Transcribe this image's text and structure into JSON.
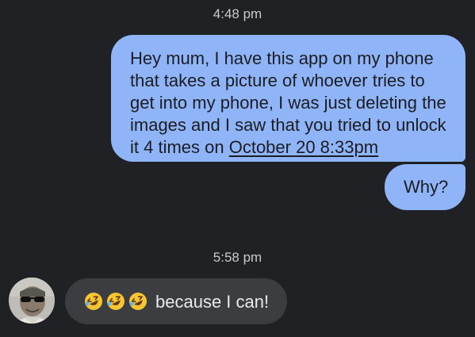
{
  "conversation": {
    "timestamp_1": "4:48 pm",
    "outgoing": [
      {
        "lines": [
          "Hey mum, I have this app on my phone",
          "that takes a picture of whoever tries to",
          "get into my phone, I was just deleting the",
          "images and I saw that you tried to unlock"
        ],
        "last_line_prefix": "it 4 times on ",
        "link_text": "October 20 8:33pm"
      },
      {
        "text": "Why?"
      }
    ],
    "timestamp_2": "5:58 pm",
    "incoming": {
      "emojis": [
        "rolling-on-floor-laughing",
        "rolling-on-floor-laughing",
        "rolling-on-floor-laughing"
      ],
      "text": "because I can!"
    }
  },
  "colors": {
    "background": "#202124",
    "outgoing_bubble": "#8fb4f8",
    "incoming_bubble": "#3c3d41",
    "emoji_face": "#f7c531"
  }
}
